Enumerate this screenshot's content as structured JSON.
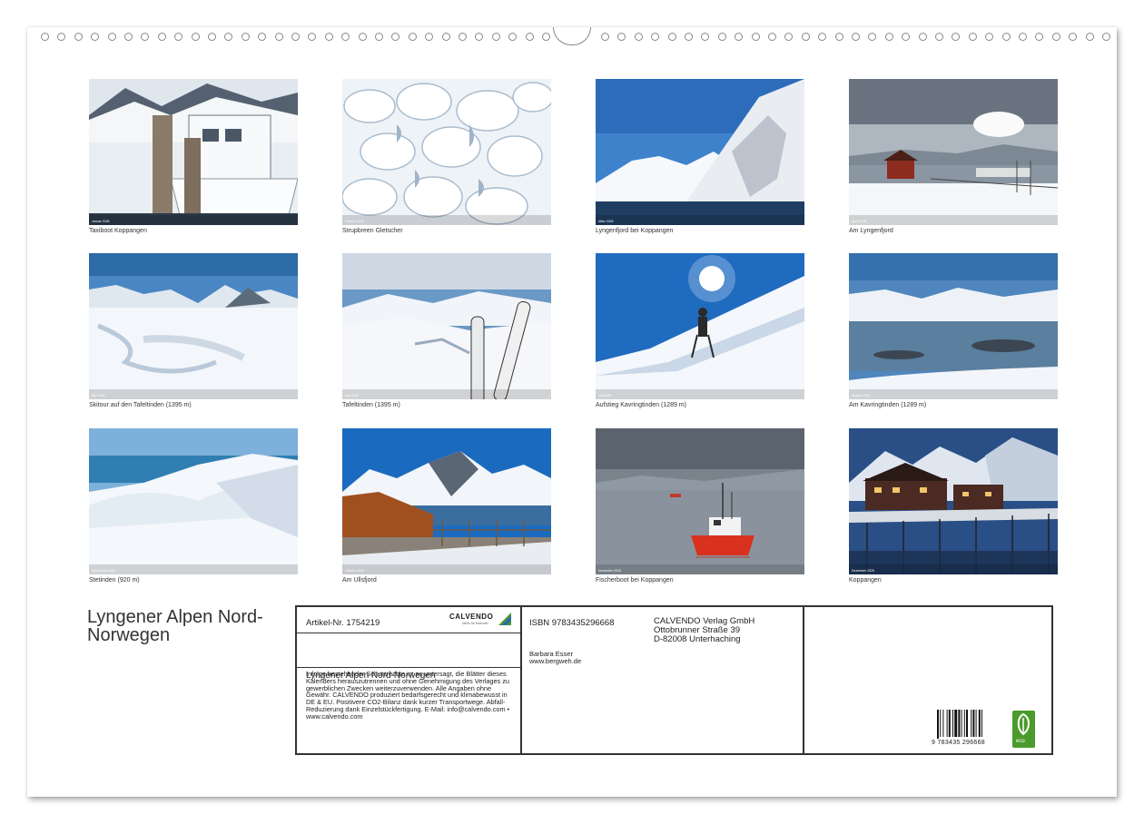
{
  "tiles": [
    {
      "caption": "Taxiboot Koppangen",
      "scene": "boat-dock",
      "month": "Januar 2026"
    },
    {
      "caption": "Strupbreen Gletscher",
      "scene": "glacier",
      "month": "Februar 2026"
    },
    {
      "caption": "Lyngenfjord bei Koppangen",
      "scene": "fjord-mountain",
      "month": "März 2026"
    },
    {
      "caption": "Am Lyngenfjord",
      "scene": "red-hut",
      "month": "April 2026"
    },
    {
      "caption": "Skitour auf den Tafeltinden (1395 m)",
      "scene": "snowfield",
      "month": "Mai 2026"
    },
    {
      "caption": "Tafeltinden (1395 m)",
      "scene": "skis",
      "month": "Juni 2026"
    },
    {
      "caption": "Aufstieg Kavringtinden (1289 m)",
      "scene": "hiker-sun",
      "month": "Juli 2026"
    },
    {
      "caption": "Am Kavringtinden (1289 m)",
      "scene": "fjord-islands",
      "month": "August 2026"
    },
    {
      "caption": "Stetinden (920 m)",
      "scene": "snow-ridge",
      "month": "September 2026"
    },
    {
      "caption": "Am Ullsfjord",
      "scene": "autumn-fjord",
      "month": "Oktober 2026"
    },
    {
      "caption": "Fischerboot bei Koppangen",
      "scene": "fishing-boat",
      "month": "November 2026"
    },
    {
      "caption": "Koppangen",
      "scene": "night-houses",
      "month": "Dezember 2026"
    }
  ],
  "title": "Lyngener Alpen Nord-Norwegen",
  "info": {
    "artikel": "Artikel-Nr. 1754219",
    "calvendo_logo": "CALVENDO",
    "calvendo_tagline": "Ideen für Kalender",
    "book_title": "Lyngener Alpen Nord-Norwegen",
    "legal": "Infolge bestehender Schutzrechte ist es untersagt, die Blätter dieses Kalenders herauszutrennen und ohne Genehmigung des Verlages zu gewerblichen Zwecken weiterzuverwenden. Alle Angaben ohne Gewähr. CALVENDO produziert bedarfsgerecht und klimabewusst in DE & EU. Positivere CO2-Bilanz dank kurzer Transportwege. Abfall-Reduzierung dank Einzelstückfertigung. E-Mail: info@calvendo.com • www.calvendo.com",
    "isbn": "ISBN 9783435296668",
    "author_name": "Barbara Esser",
    "author_web": "www.bergweh.de",
    "publisher_name": "CALVENDO Verlag GmbH",
    "publisher_street": "Ottobrunner Straße 39",
    "publisher_city": "D-82008 Unterhaching",
    "barcode_number": "9 783435 296668",
    "eco_label": "eco"
  },
  "colors": {
    "calvendo_green": "#4a9a2c",
    "border": "#333333"
  }
}
